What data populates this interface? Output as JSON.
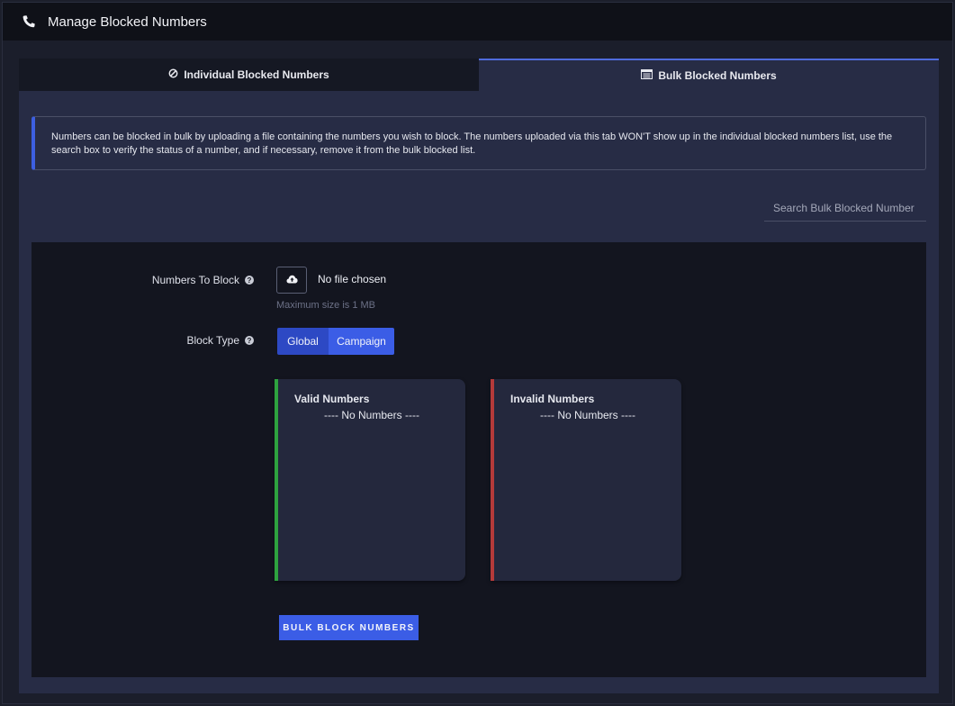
{
  "header": {
    "title": "Manage Blocked Numbers",
    "icon": "phone-icon"
  },
  "tabs": [
    {
      "label": "Individual Blocked Numbers",
      "icon": "ban-icon",
      "active": false
    },
    {
      "label": "Bulk Blocked Numbers",
      "icon": "list-icon",
      "active": true
    }
  ],
  "info": {
    "text": "Numbers can be blocked in bulk by uploading a file containing the numbers you wish to block. The numbers uploaded via this tab WON'T show up in the individual blocked numbers list, use the search box to verify the status of a number, and if necessary, remove it from the bulk blocked list."
  },
  "search": {
    "placeholder": "Search Bulk Blocked Number"
  },
  "form": {
    "numbers_to_block_label": "Numbers To Block",
    "file_status": "No file chosen",
    "max_size": "Maximum size is 1 MB",
    "block_type_label": "Block Type",
    "block_type_options": [
      "Global",
      "Campaign"
    ],
    "block_type_selected": "Campaign"
  },
  "cards": {
    "valid": {
      "title": "Valid Numbers",
      "empty": "---- No Numbers ----",
      "accent": "#2ea23f"
    },
    "invalid": {
      "title": "Invalid Numbers",
      "empty": "---- No Numbers ----",
      "accent": "#b43a3a"
    }
  },
  "actions": {
    "bulk_block_label": "BULK BLOCK NUMBERS"
  },
  "colors": {
    "primary": "#3b5de6",
    "panel": "#272c45",
    "background": "#13151f"
  }
}
